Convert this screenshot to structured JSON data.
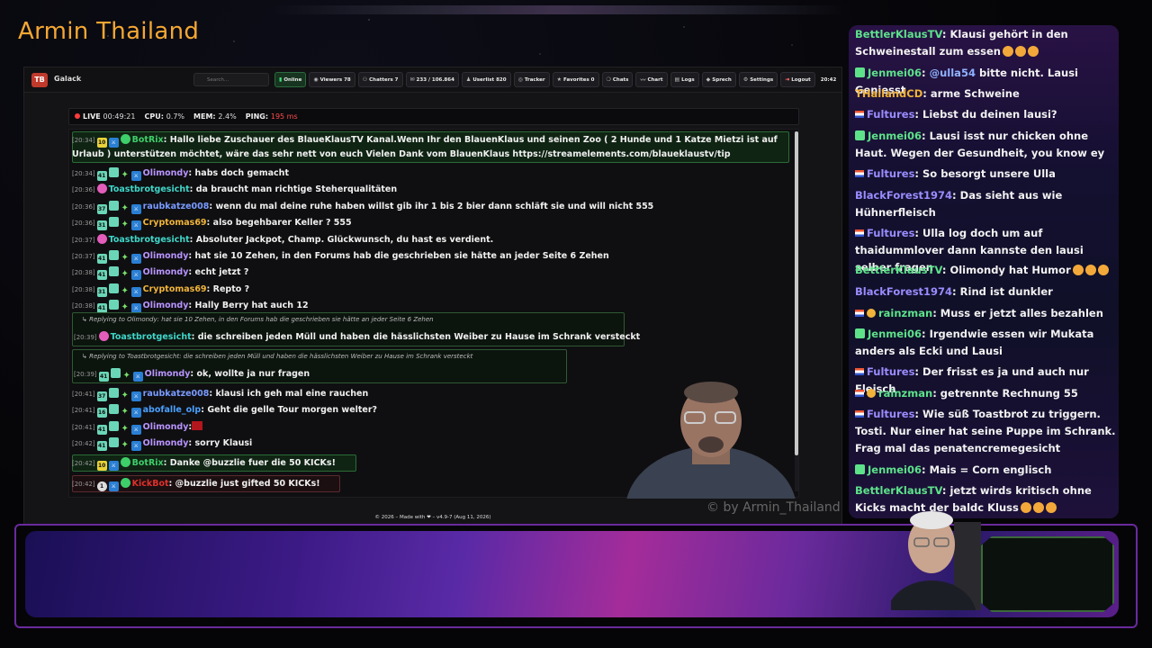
{
  "streamer_title": "Armin Thailand",
  "app": {
    "logo": "TB",
    "name": "Galack",
    "search_placeholder": "Search...",
    "nav": [
      {
        "label": "Online",
        "icon": "signal-icon"
      },
      {
        "label": "Viewers 78",
        "icon": "eye-icon"
      },
      {
        "label": "Chatters 7",
        "icon": "users-icon"
      },
      {
        "label": "233 / 106.864",
        "icon": "chat-icon"
      },
      {
        "label": "Userlist 820",
        "icon": "user-icon"
      },
      {
        "label": "Tracker",
        "icon": "target-icon"
      },
      {
        "label": "Favorites 0",
        "icon": "star-icon"
      },
      {
        "label": "Chats",
        "icon": "bubble-icon"
      },
      {
        "label": "Chart",
        "icon": "chart-icon"
      },
      {
        "label": "Logs",
        "icon": "log-icon"
      },
      {
        "label": "Sprech",
        "icon": "mic-icon"
      },
      {
        "label": "Settings",
        "icon": "gear-icon"
      },
      {
        "label": "Logout",
        "icon": "logout-icon"
      }
    ],
    "clock": "20:42",
    "status": {
      "live_label": "LIVE",
      "live_time": "00:49:21",
      "cpu_label": "CPU:",
      "cpu": "0.7%",
      "mem_label": "MEM:",
      "mem": "2.4%",
      "ping_label": "PING:",
      "ping": "195 ms"
    },
    "footer": "© 2026 – Made with ❤ – v4.9-7 (Aug 11, 2026)",
    "watermark": "© by Armin_Thailand"
  },
  "chat": {
    "bot_msg_ts": "[20:34]",
    "bot_msg_lvl": "10",
    "bot_msg_user": "BotRix",
    "bot_msg_line1": ": Hallo liebe Zuschauer des BlaueKlausTV Kanal.Wenn Ihr den BlauenKlaus und seinen Zoo ( 2 Hunde und 1 Katze Mietzi ist auf",
    "bot_msg_line2": "Urlaub ) unterstützen möchtet, wäre das sehr nett von euch Vielen Dank vom BlauenKlaus https://streamelements.com/blaueklaustv/tip",
    "messages": [
      {
        "ts": "[20:34]",
        "lvl": "41",
        "user": "Olimondy",
        "color": "#b994ff",
        "text": ": habs doch gemacht"
      },
      {
        "ts": "[20:36]",
        "lvl": "",
        "user": "Toastbrotgesicht",
        "color": "#3fd6c9",
        "text": ": da braucht man richtige Steherqualitäten"
      },
      {
        "ts": "[20:36]",
        "lvl": "37",
        "user": "raubkatze008",
        "color": "#7a9bff",
        "text": ": wenn du mal deine ruhe haben willst gib ihr 1 bis 2 bier dann schläft sie und will nicht 555"
      },
      {
        "ts": "[20:36]",
        "lvl": "31",
        "user": "Cryptomas69",
        "color": "#f0b43a",
        "text": ": also begehbarer Keller ? 555"
      },
      {
        "ts": "[20:37]",
        "lvl": "",
        "user": "Toastbrotgesicht",
        "color": "#3fd6c9",
        "text": ": Absoluter Jackpot, Champ. Glückwunsch, du hast es verdient."
      },
      {
        "ts": "[20:37]",
        "lvl": "41",
        "user": "Olimondy",
        "color": "#b994ff",
        "text": ": hat sie 10 Zehen, in den Forums hab die geschrieben sie hätte an jeder Seite 6 Zehen"
      },
      {
        "ts": "[20:38]",
        "lvl": "41",
        "user": "Olimondy",
        "color": "#b994ff",
        "text": ": echt jetzt ?"
      },
      {
        "ts": "[20:38]",
        "lvl": "31",
        "user": "Cryptomas69",
        "color": "#f0b43a",
        "text": ": Repto ?"
      },
      {
        "ts": "[20:38]",
        "lvl": "41",
        "user": "Olimondy",
        "color": "#b994ff",
        "text": ": Hally Berry hat auch 12"
      }
    ],
    "reply1_ref": "Replying to Olimondy: hat sie 10 Zehen, in den Forums hab die geschrieben sie hätte an jeder Seite 6 Zehen",
    "reply1": {
      "ts": "[20:39]",
      "user": "Toastbrotgesicht",
      "text": ": die schreiben jeden Müll und haben die hässlichsten Weiber zu Hause im Schrank versteckt"
    },
    "reply2_ref": "Replying to Toastbrotgesicht: die schreiben jeden Müll und haben die hässlichsten Weiber zu Hause im Schrank versteckt",
    "reply2": {
      "ts": "[20:39]",
      "lvl": "41",
      "user": "Olimondy",
      "text": ": ok, wollte ja nur fragen"
    },
    "messages2": [
      {
        "ts": "[20:41]",
        "lvl": "37",
        "user": "raubkatze008",
        "color": "#7a9bff",
        "text": ": klausi ich geh mal eine rauchen"
      },
      {
        "ts": "[20:41]",
        "lvl": "16",
        "user": "abofalle_olp",
        "color": "#4aa0ff",
        "text": ": Geht die gelle Tour morgen welter?"
      },
      {
        "ts": "[20:41]",
        "lvl": "41",
        "user": "Olimondy",
        "color": "#b994ff",
        "text": ":"
      },
      {
        "ts": "[20:42]",
        "lvl": "41",
        "user": "Olimondy",
        "color": "#b994ff",
        "text": ": sorry Klausi"
      }
    ],
    "bot2": {
      "ts": "[20:42]",
      "lvl": "10",
      "user": "BotRix",
      "text": ": Danke @buzzlie fuer die 50 KICKs!"
    },
    "kick": {
      "ts": "[20:42]",
      "lvl": "1",
      "user": "KickBot",
      "text": ": @buzzlie just gifted 50 KICKs!"
    }
  },
  "side_chat": [
    {
      "platform": "kick",
      "user": "BettlerKlausTV",
      "color": "#5de28a",
      "text": ": Klausi gehört in den Schweinestall zum essen",
      "emotes": 3
    },
    {
      "platform": "kick-badge",
      "user": "Jenmei06",
      "color": "#5de28a",
      "mention": "@ulla54",
      "text": " bitte nicht. Lausi Geniesst",
      "emotes": 0
    },
    {
      "platform": "none",
      "user": "THailandCD",
      "color": "#f0b43a",
      "text": ": arme Schweine",
      "emotes": 0
    },
    {
      "platform": "twitch",
      "user": "Fultures",
      "color": "#9a8cff",
      "text": ": Liebst du deinen lausi?",
      "emotes": 0
    },
    {
      "platform": "kick-badge",
      "user": "Jenmei06",
      "color": "#5de28a",
      "text": ": Lausi isst nur chicken ohne Haut. Wegen der Gesundheit, you know ey",
      "emotes": 0
    },
    {
      "platform": "twitch",
      "user": "Fultures",
      "color": "#9a8cff",
      "text": ": So besorgt unsere Ulla",
      "emotes": 0
    },
    {
      "platform": "none",
      "user": "BlackForest1974",
      "color": "#9a8cff",
      "text": ": Das sieht aus wie Hühnerfleisch",
      "emotes": 0
    },
    {
      "platform": "twitch",
      "user": "Fultures",
      "color": "#9a8cff",
      "text": ": Ulla log doch um auf thaidummlover dann kannste den lausi selber fragen",
      "emotes": 0
    },
    {
      "platform": "none",
      "user": "BettlerKlausTV",
      "color": "#5de28a",
      "text": ": Olimondy hat Humor",
      "emotes": 3
    },
    {
      "platform": "none",
      "user": "BlackForest1974",
      "color": "#9a8cff",
      "text": ": Rind ist dunkler",
      "emotes": 0
    },
    {
      "platform": "twitch-coin",
      "user": "rainzman",
      "color": "#5de28a",
      "text": ": Muss er jetzt alles bezahlen",
      "emotes": 0
    },
    {
      "platform": "kick-badge",
      "user": "Jenmei06",
      "color": "#5de28a",
      "text": ": Irgendwie essen wir Mukata anders als Ecki und Lausi",
      "emotes": 0
    },
    {
      "platform": "twitch",
      "user": "Fultures",
      "color": "#9a8cff",
      "text": ": Der frisst es ja und auch nur Fleisch",
      "emotes": 0
    },
    {
      "platform": "twitch-coin",
      "user": "rainzman",
      "color": "#5de28a",
      "text": ": getrennte Rechnung 55",
      "emotes": 0
    },
    {
      "platform": "twitch",
      "user": "Fultures",
      "color": "#9a8cff",
      "text": ": Wie süß Toastbrot zu triggern. Tosti. Nur einer hat seine Puppe im Schrank. Frag mal das penatencremegesicht",
      "emotes": 0
    },
    {
      "platform": "kick-badge",
      "user": "Jenmei06",
      "color": "#5de28a",
      "text": ": Mais = Corn englisch",
      "emotes": 0
    },
    {
      "platform": "none",
      "user": "BettlerKlausTV",
      "color": "#5de28a",
      "text": ": jetzt wirds kritisch ohne Kicks macht der baldc Kluss",
      "emotes": 3
    }
  ]
}
